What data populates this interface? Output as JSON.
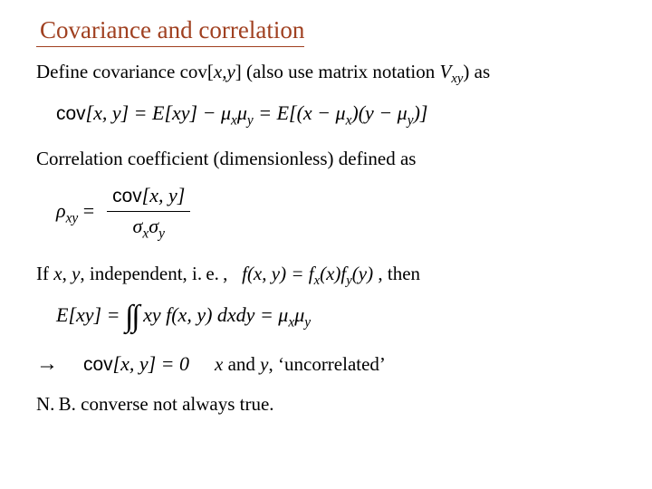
{
  "title": "Covariance and correlation",
  "p1_a": "Define covariance cov[",
  "p1_b": "] (also use matrix notation ",
  "p1_c": ") as",
  "var_x": "x",
  "var_y": "y",
  "comma_xy": "x,y",
  "Vxy": "V",
  "xy_sub": "xy",
  "eq1_lhs_cov": "cov",
  "eq1_bracket": "[x, y] = E[xy] − μ",
  "eq1_mid": "μ",
  "eq1_rhs": " = E[(x − μ",
  "eq1_rhs2": ")(y − μ",
  "eq1_rhs3": ")]",
  "p2": "Correlation coefficient (dimensionless) defined as",
  "rho": "ρ",
  "eq2_eq": " = ",
  "eq2_num_a": "cov",
  "eq2_num_b": "[x, y]",
  "eq2_den": "σ",
  "p3_a": "If ",
  "p3_b": ", independent, i.&thinsp;e.&thinsp;, ",
  "eq3": "f(x, y) = f",
  "eq3_b": "(x)f",
  "eq3_c": "(y)",
  "p3_then": " ,   then",
  "eq4_lhs": "E[xy] = ",
  "eq4_mid": " xy f(x, y) dxdy = μ",
  "arrow": "→",
  "eq5_a": "cov",
  "eq5_b": "[x, y] = 0",
  "p5_a": " and  ",
  "p5_b": ", ‘uncorrelated’",
  "p6": "N.&thinsp;B. converse not always true."
}
